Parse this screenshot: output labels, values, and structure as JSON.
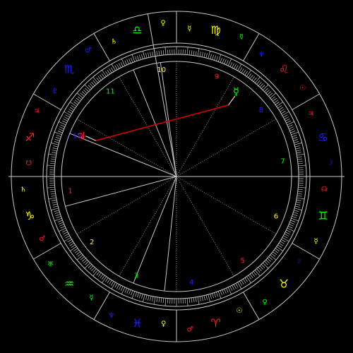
{
  "colors": {
    "background": "#000000",
    "lines": "#c8c8c8",
    "fire": "#ff2020",
    "earth": "#ffff00",
    "air": "#00ff00",
    "water": "#2020ff",
    "aspect": "#e00000"
  },
  "signs": [
    {
      "glyph": "♈",
      "color": "#ff2020",
      "ruler": "♂",
      "ruler_color": "#ff2020",
      "exalt": "☉",
      "exalt_color": "#ffff00"
    },
    {
      "glyph": "♉",
      "color": "#ffff00",
      "ruler": "♀",
      "ruler_color": "#00ff00",
      "exalt": "☽",
      "exalt_color": "#2020ff"
    },
    {
      "glyph": "♊",
      "color": "#00ff00",
      "ruler": "☿",
      "ruler_color": "#ffff00",
      "exalt": "☊",
      "exalt_color": "#ff2020"
    },
    {
      "glyph": "♋",
      "color": "#2020ff",
      "ruler": "☽",
      "ruler_color": "#2020ff",
      "exalt": "♃",
      "exalt_color": "#ff2020"
    },
    {
      "glyph": "♌",
      "color": "#ff2020",
      "ruler": "☉",
      "ruler_color": "#ff2020",
      "exalt": "♆",
      "exalt_color": "#2020ff"
    },
    {
      "glyph": "♍",
      "color": "#ffff00",
      "ruler": "☿",
      "ruler_color": "#00ff00",
      "exalt": "☿",
      "exalt_color": "#ffff00"
    },
    {
      "glyph": "♎",
      "color": "#00ff00",
      "ruler": "♀",
      "ruler_color": "#ffff00",
      "exalt": "♄",
      "exalt_color": "#ffff00"
    },
    {
      "glyph": "♏",
      "color": "#2020ff",
      "ruler": "♂",
      "ruler_color": "#2020ff",
      "exalt": "♇",
      "exalt_color": "#2020ff"
    },
    {
      "glyph": "♐",
      "color": "#ff2020",
      "ruler": "♃",
      "ruler_color": "#ff2020",
      "exalt": "☋",
      "exalt_color": "#ff2020"
    },
    {
      "glyph": "♑",
      "color": "#ffff00",
      "ruler": "♄",
      "ruler_color": "#ffff00",
      "exalt": "♂",
      "exalt_color": "#ff2020"
    },
    {
      "glyph": "♒",
      "color": "#00ff00",
      "ruler": "♅",
      "ruler_color": "#00ff00",
      "exalt": "☿",
      "exalt_color": "#00ff00"
    },
    {
      "glyph": "♓",
      "color": "#2020ff",
      "ruler": "♆",
      "ruler_color": "#2020ff",
      "exalt": "♀",
      "exalt_color": "#ffff00"
    }
  ],
  "ascendant_longitude": 270,
  "houses": [
    {
      "number": "1",
      "cusp": 270,
      "color": "#ff2020"
    },
    {
      "number": "2",
      "cusp": 300,
      "color": "#ffff00"
    },
    {
      "number": "3",
      "cusp": 330,
      "color": "#00ff00"
    },
    {
      "number": "4",
      "cusp": 0,
      "color": "#2020ff"
    },
    {
      "number": "5",
      "cusp": 30,
      "color": "#ff2020"
    },
    {
      "number": "6",
      "cusp": 60,
      "color": "#ffff00"
    },
    {
      "number": "7",
      "cusp": 90,
      "color": "#00ff00"
    },
    {
      "number": "8",
      "cusp": 120,
      "color": "#2020ff"
    },
    {
      "number": "9",
      "cusp": 150,
      "color": "#ff2020"
    },
    {
      "number": "10",
      "cusp": 180,
      "color": "#ffff00"
    },
    {
      "number": "11",
      "cusp": 210,
      "color": "#00ff00"
    },
    {
      "number": "12",
      "cusp": 240,
      "color": "#2020ff"
    }
  ],
  "extra_cusp_lines": [
    188,
    202,
    248,
    285,
    338,
    354
  ],
  "planets": [
    {
      "name": "Jupiter",
      "glyph": "♃",
      "color": "#ff2020",
      "longitude": 246
    },
    {
      "name": "Mercury",
      "glyph": "☿",
      "color": "#00ff00",
      "longitude": 144
    }
  ],
  "aspects": [
    {
      "from": "Jupiter",
      "to": "Mercury",
      "color": "#e00000"
    }
  ]
}
